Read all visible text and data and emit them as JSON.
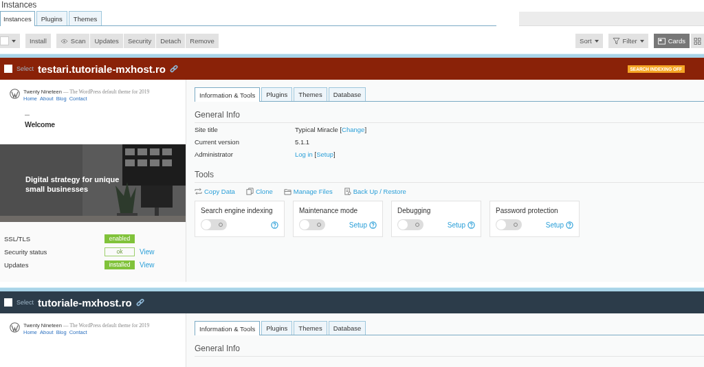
{
  "page": {
    "heading": "Instances"
  },
  "tabs": [
    {
      "label": "Instances",
      "selected": true
    },
    {
      "label": "Plugins",
      "selected": false
    },
    {
      "label": "Themes",
      "selected": false
    }
  ],
  "toolbar": {
    "left": [
      {
        "label": "Install"
      },
      {
        "label": "Scan"
      },
      {
        "label": "Updates"
      },
      {
        "label": "Security"
      },
      {
        "label": "Detach"
      },
      {
        "label": "Remove"
      }
    ],
    "right": [
      {
        "label": "Sort",
        "selected": false
      },
      {
        "label": "Filter",
        "selected": false
      },
      {
        "label": "Cards",
        "selected": true
      }
    ],
    "view_switch": {
      "selected": false
    }
  },
  "instances": [
    {
      "select_label": "Select",
      "domain": "testari.tutoriale-mxhost.ro",
      "color": "#8a2208",
      "badge": "SEARCH INDEXING OFF",
      "preview": {
        "site_name": "Twenty Nineteen",
        "tagline": "— The WordPress default theme for 2019",
        "nav": [
          "Home",
          "About",
          "Blog",
          "Contact"
        ],
        "heading": "Welcome",
        "hero_text": "Digital strategy for unique small businesses"
      },
      "status": [
        {
          "label": "SSL/TLS",
          "value": "enabled",
          "kind": "filled"
        },
        {
          "label": "Security status",
          "value": "ok",
          "kind": "outline",
          "link": "View"
        },
        {
          "label": "Updates",
          "value": "installed",
          "kind": "filled",
          "link": "View"
        }
      ],
      "tabs": [
        {
          "label": "Information & Tools",
          "selected": true
        },
        {
          "label": "Plugins",
          "selected": false
        },
        {
          "label": "Themes",
          "selected": false
        },
        {
          "label": "Database",
          "selected": false
        }
      ],
      "general_info": {
        "title": "General Info",
        "rows": [
          {
            "label": "Site title",
            "parts": [
              {
                "kind": "text",
                "text": "Typical Miracle ["
              },
              {
                "kind": "link",
                "text": "Change"
              },
              {
                "kind": "text",
                "text": "]"
              }
            ]
          },
          {
            "label": "Current version",
            "parts": [
              {
                "kind": "text",
                "text": "5.1.1"
              }
            ]
          },
          {
            "label": "Administrator",
            "parts": [
              {
                "kind": "link",
                "text": "Log in"
              },
              {
                "kind": "text",
                "text": " ["
              },
              {
                "kind": "link",
                "text": "Setup"
              },
              {
                "kind": "text",
                "text": "]"
              }
            ]
          }
        ]
      },
      "tools": {
        "title": "Tools",
        "actions": [
          {
            "label": "Copy Data"
          },
          {
            "label": "Clone"
          },
          {
            "label": "Manage Files"
          },
          {
            "label": "Back Up / Restore"
          }
        ],
        "toggles": [
          {
            "label": "Search engine indexing",
            "on": false
          },
          {
            "label": "Maintenance mode",
            "on": false,
            "setup": "Setup"
          },
          {
            "label": "Debugging",
            "on": false,
            "setup": "Setup"
          },
          {
            "label": "Password protection",
            "on": false,
            "setup": "Setup"
          }
        ]
      }
    },
    {
      "select_label": "Select",
      "domain": "tutoriale-mxhost.ro",
      "color": "#2c3c4a",
      "preview": {
        "site_name": "Twenty Nineteen",
        "tagline": "— The WordPress default theme for 2019",
        "nav": [
          "Home",
          "About",
          "Blog",
          "Contact"
        ]
      },
      "tabs": [
        {
          "label": "Information & Tools",
          "selected": true
        },
        {
          "label": "Plugins",
          "selected": false
        },
        {
          "label": "Themes",
          "selected": false
        },
        {
          "label": "Database",
          "selected": false
        }
      ],
      "general_info": {
        "title": "General Info"
      }
    }
  ]
}
